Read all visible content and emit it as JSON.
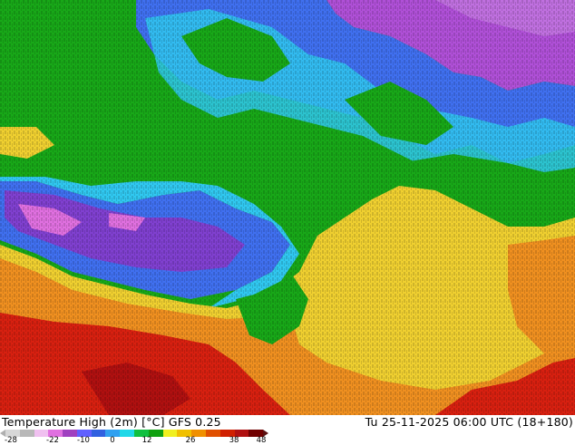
{
  "map": {
    "title": "Temperature High (2m) [°C] GFS 0.25",
    "valid_time": "Tu 25-11-2025 06:00 UTC (18+180)"
  },
  "legend": {
    "ticks": [
      "-28",
      "-22",
      "-10",
      "0",
      "12",
      "26",
      "38",
      "48"
    ],
    "colors": [
      "#d8d8d8",
      "#b8b8b8",
      "#f0c0f0",
      "#e070e0",
      "#a040c0",
      "#6060ff",
      "#3060e0",
      "#30a0f0",
      "#20d8e8",
      "#10c040",
      "#10a010",
      "#f0f020",
      "#f0c000",
      "#f09000",
      "#e05000",
      "#d02000",
      "#b01010",
      "#700000"
    ]
  },
  "regions": {
    "land_color": "#18a818",
    "north_purple": "#b050d8",
    "cold_blue": "#4070f0",
    "cyan": "#30c8f0",
    "yellow": "#f0d030",
    "orange": "#f09020",
    "red": "#d82010"
  }
}
